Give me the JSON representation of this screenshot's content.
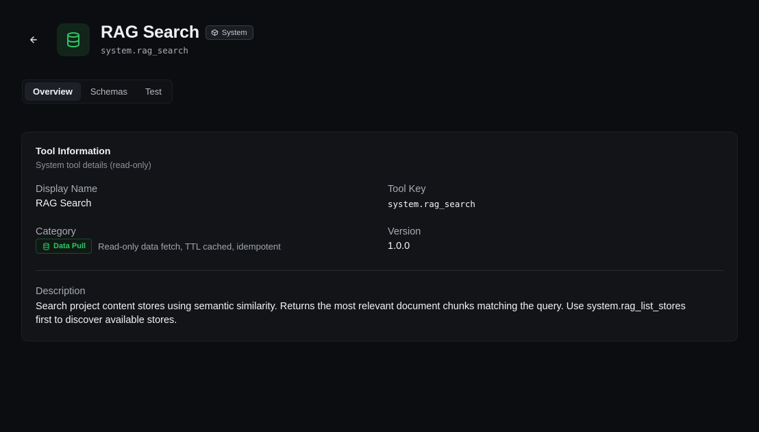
{
  "header": {
    "title": "RAG Search",
    "badge": "System",
    "subtitle": "system.rag_search",
    "icon": "database-icon",
    "icon_color": "#2fc563"
  },
  "tabs": [
    {
      "label": "Overview",
      "active": true
    },
    {
      "label": "Schemas",
      "active": false
    },
    {
      "label": "Test",
      "active": false
    }
  ],
  "card": {
    "title": "Tool Information",
    "subtitle": "System tool details (read-only)",
    "display_name": {
      "label": "Display Name",
      "value": "RAG Search"
    },
    "tool_key": {
      "label": "Tool Key",
      "value": "system.rag_search"
    },
    "category": {
      "label": "Category",
      "badge": "Data Pull",
      "badge_color": "#2fc563",
      "description": "Read-only data fetch, TTL cached, idempotent"
    },
    "version": {
      "label": "Version",
      "value": "1.0.0"
    },
    "description": {
      "label": "Description",
      "value": "Search project content stores using semantic similarity. Returns the most relevant document chunks matching the query. Use system.rag_list_stores first to discover available stores."
    }
  }
}
